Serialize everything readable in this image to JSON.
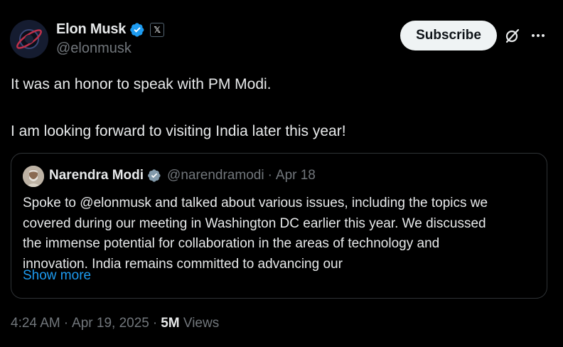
{
  "author": {
    "display_name": "Elon Musk",
    "handle": "@elonmusk",
    "affiliate_badge": "𝕏"
  },
  "actions": {
    "subscribe_label": "Subscribe",
    "grok_icon": "grok-icon",
    "more_icon": "more-icon"
  },
  "tweet": {
    "line1": "It was an honor to speak with PM Modi.",
    "line2": "I am looking forward to visiting India later this year!"
  },
  "quote": {
    "display_name": "Narendra Modi",
    "handle": "@narendramodi",
    "separator": "·",
    "date": "Apr 18",
    "lines": [
      "Spoke to @elonmusk and talked about various issues, including the topics we",
      "covered during our meeting in Washington DC earlier this year. We discussed",
      "the immense potential for collaboration in the areas of technology and",
      "innovation. India remains committed to advancing our"
    ],
    "show_more": "Show more"
  },
  "meta": {
    "time": "4:24 AM",
    "sep1": "·",
    "date": "Apr 19, 2025",
    "sep2": "·",
    "views_count": "5M",
    "views_label": "Views"
  },
  "colors": {
    "background": "#000000",
    "text": "#e7e9ea",
    "muted": "#71767b",
    "link": "#1d9bf0",
    "verified": "#1d9bf0",
    "border": "#2f3336"
  }
}
